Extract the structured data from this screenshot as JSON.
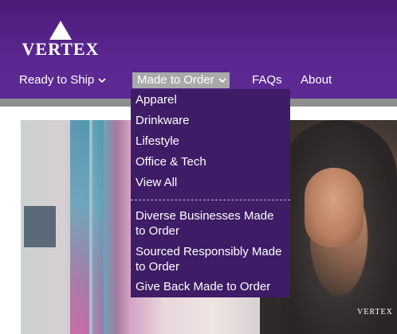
{
  "brand": {
    "logo_text": "VERTEX"
  },
  "nav": {
    "items": [
      {
        "label": "Ready to Ship",
        "has_dropdown": true
      },
      {
        "label": "Made to Order",
        "has_dropdown": true,
        "active": true
      },
      {
        "label": "FAQs",
        "has_dropdown": false
      },
      {
        "label": "About",
        "has_dropdown": false
      }
    ]
  },
  "dropdown": {
    "primary": [
      "Apparel",
      "Drinkware",
      "Lifestyle",
      "Office & Tech",
      "View All"
    ],
    "secondary": [
      "Diverse Businesses Made to Order",
      "Sourced Responsibly Made to Order",
      "Give Back Made to Order"
    ]
  },
  "hero": {
    "apparel_logo_text": "VERTEX"
  },
  "colors": {
    "header_purple": "#4a1a78",
    "dropdown_purple": "#3e1c66",
    "active_tab_gray": "#a9a9a9",
    "band_gray": "#8e8e8e"
  }
}
